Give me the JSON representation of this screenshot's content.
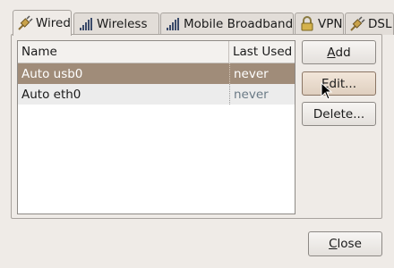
{
  "tabs": [
    {
      "label": "Wired",
      "icon": "wired-plug-icon",
      "active": true
    },
    {
      "label": "Wireless",
      "icon": "wireless-signal-icon",
      "active": false
    },
    {
      "label": "Mobile Broadband",
      "icon": "mobile-signal-icon",
      "active": false
    },
    {
      "label": "VPN",
      "icon": "lock-icon",
      "active": false
    },
    {
      "label": "DSL",
      "icon": "dsl-plug-icon",
      "active": false
    }
  ],
  "list": {
    "columns": [
      "Name",
      "Last Used"
    ],
    "rows": [
      {
        "name": "Auto usb0",
        "last_used": "never",
        "selected": true
      },
      {
        "name": "Auto eth0",
        "last_used": "never",
        "selected": false
      }
    ]
  },
  "buttons": {
    "add": {
      "mnemonic": "A",
      "rest": "dd"
    },
    "edit": {
      "mnemonic": "E",
      "rest": "dit..."
    },
    "delete": {
      "label": "Delete..."
    },
    "close": {
      "mnemonic": "C",
      "rest": "lose"
    }
  },
  "colors": {
    "selection": "#a08c79",
    "window_bg": "#efebe7"
  }
}
